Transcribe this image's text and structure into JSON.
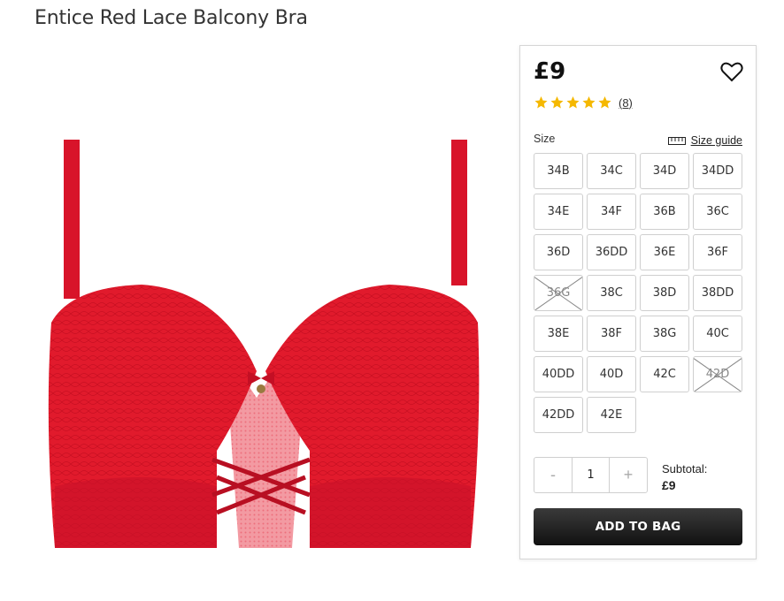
{
  "product": {
    "title": "Entice Red Lace Balcony Bra",
    "price": "£9",
    "rating_stars": 5,
    "review_count": "(8)"
  },
  "size": {
    "label": "Size",
    "guide_label": "Size guide",
    "options": [
      {
        "label": "34B",
        "available": true
      },
      {
        "label": "34C",
        "available": true
      },
      {
        "label": "34D",
        "available": true
      },
      {
        "label": "34DD",
        "available": true
      },
      {
        "label": "34E",
        "available": true
      },
      {
        "label": "34F",
        "available": true
      },
      {
        "label": "36B",
        "available": true
      },
      {
        "label": "36C",
        "available": true
      },
      {
        "label": "36D",
        "available": true
      },
      {
        "label": "36DD",
        "available": true
      },
      {
        "label": "36E",
        "available": true
      },
      {
        "label": "36F",
        "available": true
      },
      {
        "label": "36G",
        "available": false
      },
      {
        "label": "38C",
        "available": true
      },
      {
        "label": "38D",
        "available": true
      },
      {
        "label": "38DD",
        "available": true
      },
      {
        "label": "38E",
        "available": true
      },
      {
        "label": "38F",
        "available": true
      },
      {
        "label": "38G",
        "available": true
      },
      {
        "label": "40C",
        "available": true
      },
      {
        "label": "40DD",
        "available": true
      },
      {
        "label": "40D",
        "available": true
      },
      {
        "label": "42C",
        "available": true
      },
      {
        "label": "42D",
        "available": false
      },
      {
        "label": "42DD",
        "available": true
      },
      {
        "label": "42E",
        "available": true
      }
    ]
  },
  "quantity": {
    "minus": "-",
    "value": "1",
    "plus": "+"
  },
  "subtotal": {
    "label": "Subtotal:",
    "value": "£9"
  },
  "cart": {
    "add_label": "ADD TO BAG"
  },
  "colors": {
    "product_red": "#e0162b",
    "star_gold": "#f5b800",
    "button_dark": "#1e1e1e"
  }
}
